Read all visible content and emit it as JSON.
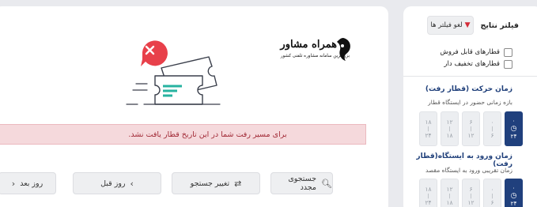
{
  "results": {
    "no_train_message": "برای مسیر رفت شما در این تاریخ قطار یافت نشد.",
    "watermark": {
      "title": "همراه مشاور",
      "subtitle": "بزرگترین سامانه مشاوره تلفنی کشور"
    },
    "actions": {
      "search_again": "جستجوی مجدد",
      "change_search": "تغییر جستجو",
      "previous_day": "روز قبل",
      "next_day": "روز بعد"
    }
  },
  "sidebar": {
    "title": "فیلتر نتایج",
    "clear_filters": "لغو فیلتر ها",
    "checkboxes": [
      {
        "label": "قطارهای قابل فروش",
        "checked": false
      },
      {
        "label": "قطارهای تخفیف دار",
        "checked": false
      }
    ],
    "departure": {
      "title": "زمان حرکت (قطار رفت)",
      "subtitle": "بازه زمانی حضور در ایستگاه قطار",
      "slots": [
        {
          "from": "۰",
          "to": "۶",
          "active": false
        },
        {
          "from": "۶",
          "to": "۱۲",
          "active": false
        },
        {
          "from": "۱۲",
          "to": "۱۸",
          "active": false
        },
        {
          "from": "۱۸",
          "to": "۲۴",
          "active": false
        }
      ],
      "active_slot": {
        "from": "۰",
        "to": "۲۴"
      }
    },
    "arrival": {
      "title": "زمان ورود به ایستگاه(قطار رفت)",
      "subtitle": "زمان تقریبی ورود به ایستگاه مقصد",
      "slots": [
        {
          "from": "۰",
          "to": "۶",
          "active": false
        },
        {
          "from": "۶",
          "to": "۱۲",
          "active": false
        },
        {
          "from": "۱۲",
          "to": "۱۸",
          "active": false
        },
        {
          "from": "۱۸",
          "to": "۲۴",
          "active": false
        }
      ],
      "active_slot": {
        "from": "۰",
        "to": "۲۴"
      }
    }
  },
  "colors": {
    "primary": "#20407d",
    "alert_bg": "#f5d9dc",
    "alert_text": "#a12a36",
    "accent_red": "#e8404a",
    "accent_teal": "#27b3a0"
  }
}
